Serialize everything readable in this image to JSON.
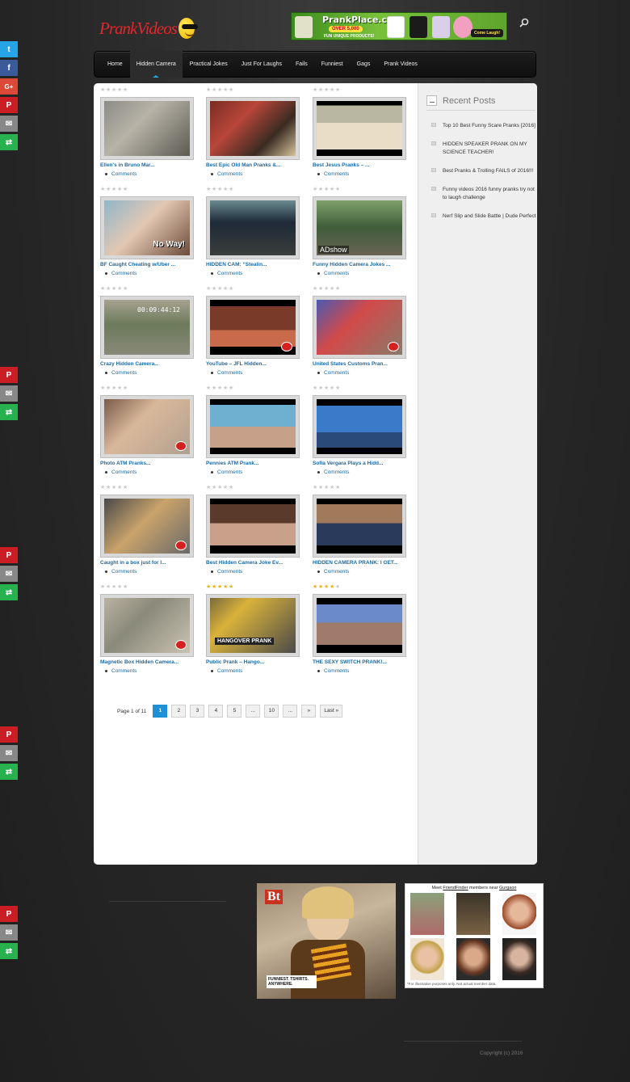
{
  "header": {
    "logo_text": "PrankVideos",
    "ad": {
      "title": "PrankPlace.com",
      "subtitle": "OVER 5,000",
      "subtitle2": "FUN UNIQUE PRODUCTS!",
      "cta": "Come Laugh!"
    }
  },
  "nav": {
    "items": [
      "Home",
      "Hidden Camera",
      "Practical Jokes",
      "Just For Laughs",
      "Fails",
      "Funniest",
      "Gags",
      "Prank Videos"
    ],
    "active": "Hidden Camera"
  },
  "videos": [
    {
      "title": "Ellen's in Bruno Mar...",
      "comments": "Comments",
      "rating": 0
    },
    {
      "title": "Best Epic Old Man Pranks &...",
      "comments": "Comments",
      "rating": 0
    },
    {
      "title": "Best Jesus Pranks – ...",
      "comments": "Comments",
      "rating": 0
    },
    {
      "title": "BF Caught Cheating w/Uber ...",
      "comments": "Comments",
      "rating": 0
    },
    {
      "title": "HIDDEN CAM: “Stealin...",
      "comments": "Comments",
      "rating": 0
    },
    {
      "title": "Funny Hidden Camera Jokes ...",
      "comments": "Comments",
      "rating": 0
    },
    {
      "title": "Crazy Hidden Camera...",
      "comments": "Comments",
      "rating": 0
    },
    {
      "title": "YouTube – JFL Hidden...",
      "comments": "Comments",
      "rating": 0
    },
    {
      "title": "United States Customs Pran...",
      "comments": "Comments",
      "rating": 0
    },
    {
      "title": "Photo ATM Pranks...",
      "comments": "Comments",
      "rating": 0
    },
    {
      "title": "Pennies ATM Prank...",
      "comments": "Comments",
      "rating": 0
    },
    {
      "title": "Sofia Vergara Plays a Hidd...",
      "comments": "Comments",
      "rating": 0
    },
    {
      "title": "Caught in a box just for l...",
      "comments": "Comments",
      "rating": 0
    },
    {
      "title": "Best Hidden Camera Joke Ev...",
      "comments": "Comments",
      "rating": 0
    },
    {
      "title": "HIDDEN CAMERA PRANK: I GET...",
      "comments": "Comments",
      "rating": 0
    },
    {
      "title": "Magnetic Box Hidden Camera...",
      "comments": "Comments",
      "rating": 0
    },
    {
      "title": "Public Prank – Hango...",
      "comments": "Comments",
      "rating": 5
    },
    {
      "title": "THE SEXY SWITCH PRANK!...",
      "comments": "Comments",
      "rating": 4
    }
  ],
  "thumb_overlays": {
    "no_way": "No Way!",
    "timestamp": "00:09:44:12",
    "adshow": "ADshow",
    "hangover": "HANGOVER PRANK"
  },
  "pagination": {
    "label": "Page 1 of 11",
    "pages": [
      "1",
      "2",
      "3",
      "4",
      "5",
      "...",
      "10",
      "...",
      "»",
      "Last »"
    ],
    "current": "1"
  },
  "sidebar": {
    "title": "Recent Posts",
    "posts": [
      "Top 10 Best Funny Scare Pranks [2016]",
      "HIDDEN SPEAKER PRANK ON MY SCIENCE TEACHER!",
      "Best Pranks & Trolling FAILS of 2016!!!",
      "Funny videos 2016 funny pranks try not to laugh challenge",
      "Nerf Slip and Slide Battle | Dude Perfect"
    ]
  },
  "footer": {
    "ad1_brand": "Bt",
    "ad1_tagline": "FUNNIEST. TSHIRTS. ANYWHERE.",
    "ad2_head_prefix": "Meet",
    "ad2_head_link": "FriendFinder",
    "ad2_head_mid": "members near",
    "ad2_head_city": "Gurgaon",
    "ad2_foot": "*For illustrative purposes only. Not actual member data.",
    "copyright": "Copyright (c) 2016"
  },
  "share_icons": [
    "twitter-icon",
    "facebook-icon",
    "google-plus-icon",
    "pinterest-icon",
    "email-icon",
    "more-icon"
  ]
}
